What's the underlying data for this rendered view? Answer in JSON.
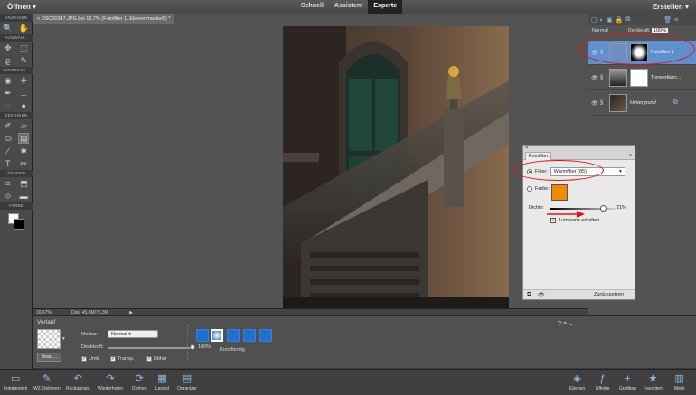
{
  "topbar": {
    "open": "Öffnen ▾",
    "modes": [
      "Schnell",
      "Assistent",
      "Experte"
    ],
    "active_mode": "Experte",
    "create": "Erstellen ▾"
  },
  "toolbox": {
    "sections": [
      "ANZEIGEN",
      "AUSWÄH...",
      "VERBESSE...",
      "ZEICHNEN",
      "ÄNDERN",
      "FARBE"
    ]
  },
  "document": {
    "tab_title": "× DSC00347.JPG bei 16,7% (Fotofilter 1, Ebenenmaske/8) *",
    "zoom": "16,67%",
    "doc_info": "Dok: 45,9M/76,3M"
  },
  "options": {
    "title": "Verlauf",
    "mode_label": "Modus:",
    "mode_value": "Normal",
    "opacity_label": "Deckkraft:",
    "opacity_value": "100%",
    "opacity_level": 1.0,
    "edit_button": "Bear. ...",
    "checkboxes": [
      {
        "label": "Umk.",
        "checked": true
      },
      {
        "label": "Transp.",
        "checked": true
      },
      {
        "label": "Dither",
        "checked": true
      }
    ],
    "gradient_type_label": "Kreisförmig"
  },
  "layers": {
    "blend_mode": "Normal",
    "opacity_label": "Deckkraft:",
    "opacity_value": "100%",
    "items": [
      {
        "name": "Fotofilter 1",
        "selected": true
      },
      {
        "name": "Tonwertkorr...",
        "selected": false
      },
      {
        "name": "Hintergrund",
        "selected": false
      }
    ]
  },
  "dialog": {
    "tab": "Fotofilter",
    "filter_label": "Filter:",
    "filter_value": "Warmfilter (85)",
    "color_label": "Farbe:",
    "color_swatch": "#f08a00",
    "density_label": "Dichte:",
    "density_value": "71%",
    "density_level": 0.71,
    "luminance_label": "Luminanz erhalten",
    "luminance_checked": true,
    "reset": "Zurücksetzen"
  },
  "taskbar": {
    "left": [
      "Fotobereich",
      "WZ-Optionen",
      "Rückgängig",
      "Wiederholen",
      "Drehen",
      "Layout",
      "Organizer"
    ],
    "right": [
      "Ebenen",
      "Effekte",
      "Grafiken",
      "Favoriten",
      "Mehr"
    ]
  },
  "colors": {
    "accent": "#5f8fcf",
    "annotation": "#e0101a",
    "orange": "#f08a00"
  }
}
